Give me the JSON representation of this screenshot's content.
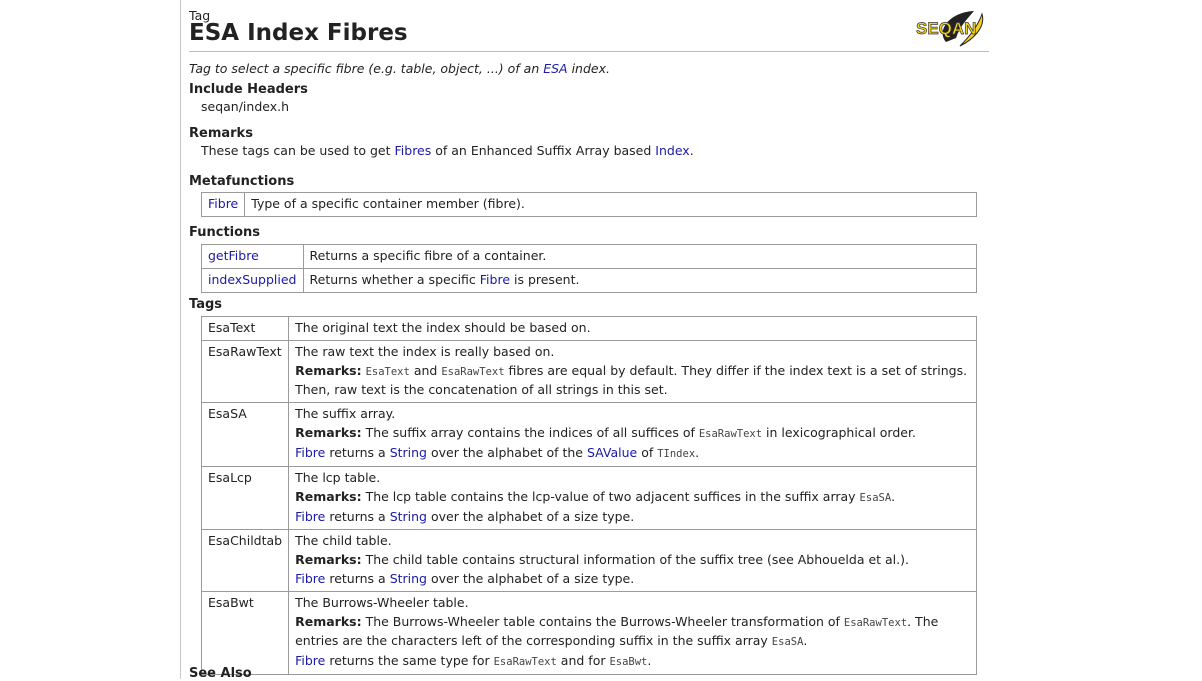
{
  "header": {
    "kind": "Tag",
    "title": "ESA Index Fibres",
    "logo_text": "SEQAN"
  },
  "summary": {
    "pre": "Tag to select a specific fibre (e.g. table, object, ...) of an ",
    "link": "ESA",
    "post": " index."
  },
  "include": {
    "heading": "Include Headers",
    "value": "seqan/index.h"
  },
  "remarks": {
    "heading": "Remarks",
    "pre": "These tags can be used to get ",
    "link1": "Fibres",
    "mid": " of an Enhanced Suffix Array based ",
    "link2": "Index",
    "post": "."
  },
  "metafunctions": {
    "heading": "Metafunctions",
    "rows": [
      {
        "name": "Fibre",
        "desc": "Type of a specific container member (fibre)."
      }
    ]
  },
  "functions": {
    "heading": "Functions",
    "rows": [
      {
        "name": "getFibre",
        "desc": "Returns a specific fibre of a container."
      },
      {
        "name": "indexSupplied",
        "desc_pre": "Returns whether a specific ",
        "desc_link": "Fibre",
        "desc_post": " is present."
      }
    ]
  },
  "tags": {
    "heading": "Tags",
    "remarks_label": "Remarks:",
    "rows": [
      {
        "name": "EsaText",
        "desc": "The original text the index should be based on."
      },
      {
        "name": "EsaRawText",
        "desc": "The raw text the index is really based on.",
        "r_c1": "EsaText",
        "r_t1": " and ",
        "r_c2": "EsaRawText",
        "r_t2": " fibres are equal by default. They differ if the index text is a set of strings. Then, raw text is the concatenation of all strings in this set."
      },
      {
        "name": "EsaSA",
        "desc": "The suffix array.",
        "r_t1": " The suffix array contains the indices of all suffices of ",
        "r_c1": "EsaRawText",
        "r_t2": " in lexicographical order.",
        "f_link": "Fibre",
        "f_t1": " returns a ",
        "f_link2": "String",
        "f_t2": " over the alphabet of the ",
        "f_link3": "SAValue",
        "f_t3": " of ",
        "f_code": "TIndex",
        "f_t4": "."
      },
      {
        "name": "EsaLcp",
        "desc": "The lcp table.",
        "r_t1": " The lcp table contains the lcp-value of two adjacent suffices in the suffix array ",
        "r_c1": "EsaSA",
        "r_t2": ".",
        "f_link": "Fibre",
        "f_t1": " returns a ",
        "f_link2": "String",
        "f_t2": " over the alphabet of a size type."
      },
      {
        "name": "EsaChildtab",
        "desc": "The child table.",
        "r_t1": " The child table contains structural information of the suffix tree (see Abhouelda et al.).",
        "f_link": "Fibre",
        "f_t1": " returns a ",
        "f_link2": "String",
        "f_t2": " over the alphabet of a size type."
      },
      {
        "name": "EsaBwt",
        "desc": "The Burrows-Wheeler table.",
        "r_t1": " The Burrows-Wheeler table contains the Burrows-Wheeler transformation of ",
        "r_c1": "EsaRawText",
        "r_t2": ". The entries are the characters left of the corresponding suffix in the suffix array ",
        "r_c2": "EsaSA",
        "r_t3": ".",
        "f_link": "Fibre",
        "f_t1": " returns the same type for ",
        "f_c1": "EsaRawText",
        "f_t2": " and for ",
        "f_c2": "EsaBwt",
        "f_t3": "."
      }
    ]
  },
  "see_also": {
    "heading": "See Also"
  }
}
